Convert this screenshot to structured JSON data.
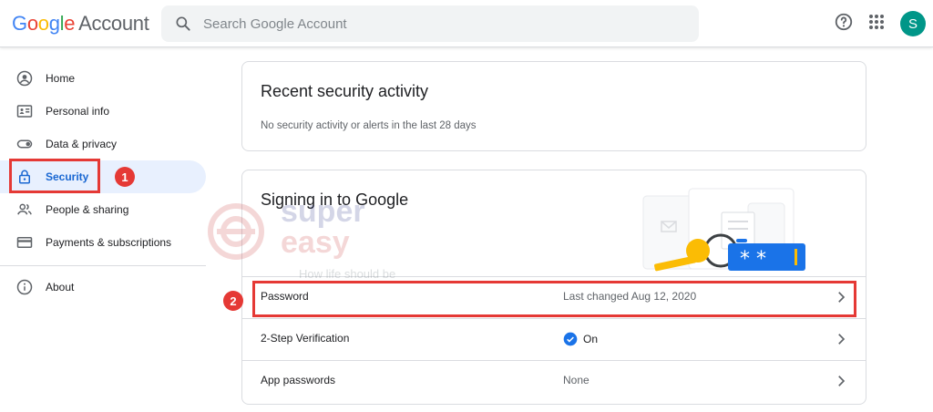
{
  "header": {
    "logo_google": [
      "G",
      "o",
      "o",
      "g",
      "l",
      "e"
    ],
    "logo_account": "Account",
    "search_placeholder": "Search Google Account",
    "avatar_letter": "S"
  },
  "sidebar": {
    "items": [
      {
        "label": "Home",
        "icon": "account-circle-icon"
      },
      {
        "label": "Personal info",
        "icon": "id-card-icon"
      },
      {
        "label": "Data & privacy",
        "icon": "toggle-icon"
      },
      {
        "label": "Security",
        "icon": "lock-icon",
        "active": true
      },
      {
        "label": "People & sharing",
        "icon": "people-icon"
      },
      {
        "label": "Payments & subscriptions",
        "icon": "credit-card-icon"
      },
      {
        "label": "About",
        "icon": "info-icon"
      }
    ]
  },
  "callouts": {
    "one": "1",
    "two": "2"
  },
  "recent_activity": {
    "title": "Recent security activity",
    "subtitle": "No security activity or alerts in the last 28 days"
  },
  "signing_in": {
    "title": "Signing in to Google",
    "rows": [
      {
        "label": "Password",
        "value": "Last changed Aug 12, 2020"
      },
      {
        "label": "2-Step Verification",
        "value": "On"
      },
      {
        "label": "App passwords",
        "value": "None"
      }
    ]
  },
  "watermark": {
    "line1": "super",
    "line2": "easy",
    "tagline": "How life should be"
  },
  "colors": {
    "accent": "#1a73e8",
    "active_bg": "#e8f0fe",
    "callout_red": "#e53935",
    "avatar": "#009688"
  }
}
